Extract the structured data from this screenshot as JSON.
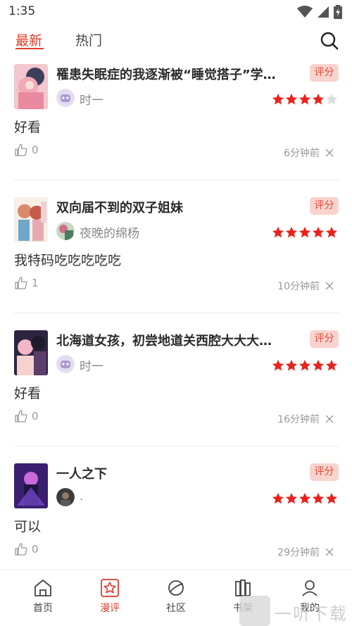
{
  "status_bar": {
    "time": "1:35"
  },
  "tabs": {
    "latest": "最新",
    "hot": "热门"
  },
  "reviews": [
    {
      "title": "罹患失眠症的我逐渐被“睡觉搭子”学…",
      "badge": "评分",
      "user": "时一",
      "stars": 4,
      "content": "好看",
      "likes": "0",
      "time": "6分钟前"
    },
    {
      "title": "双向届不到的双子姐妹",
      "badge": "评分",
      "user": "夜晚的绵杨",
      "stars": 5,
      "content": "我特码吃吃吃吃吃",
      "likes": "1",
      "time": "10分钟前"
    },
    {
      "title": "北海道女孩，初尝地道关西腔大大大…",
      "badge": "评分",
      "user": "时一",
      "stars": 5,
      "content": "好看",
      "likes": "0",
      "time": "16分钟前"
    },
    {
      "title": "一人之下",
      "badge": "评分",
      "user": ".",
      "stars": 5,
      "content": "可以",
      "likes": "0",
      "time": "29分钟前"
    }
  ],
  "nav": {
    "home": "首页",
    "review": "漫评",
    "community": "社区",
    "shelf": "书架",
    "mine": "我的"
  },
  "watermark": "一听下载",
  "colors": {
    "accent": "#e03b2a",
    "star": "#e8231c",
    "badge_bg": "#f9d3ce"
  }
}
